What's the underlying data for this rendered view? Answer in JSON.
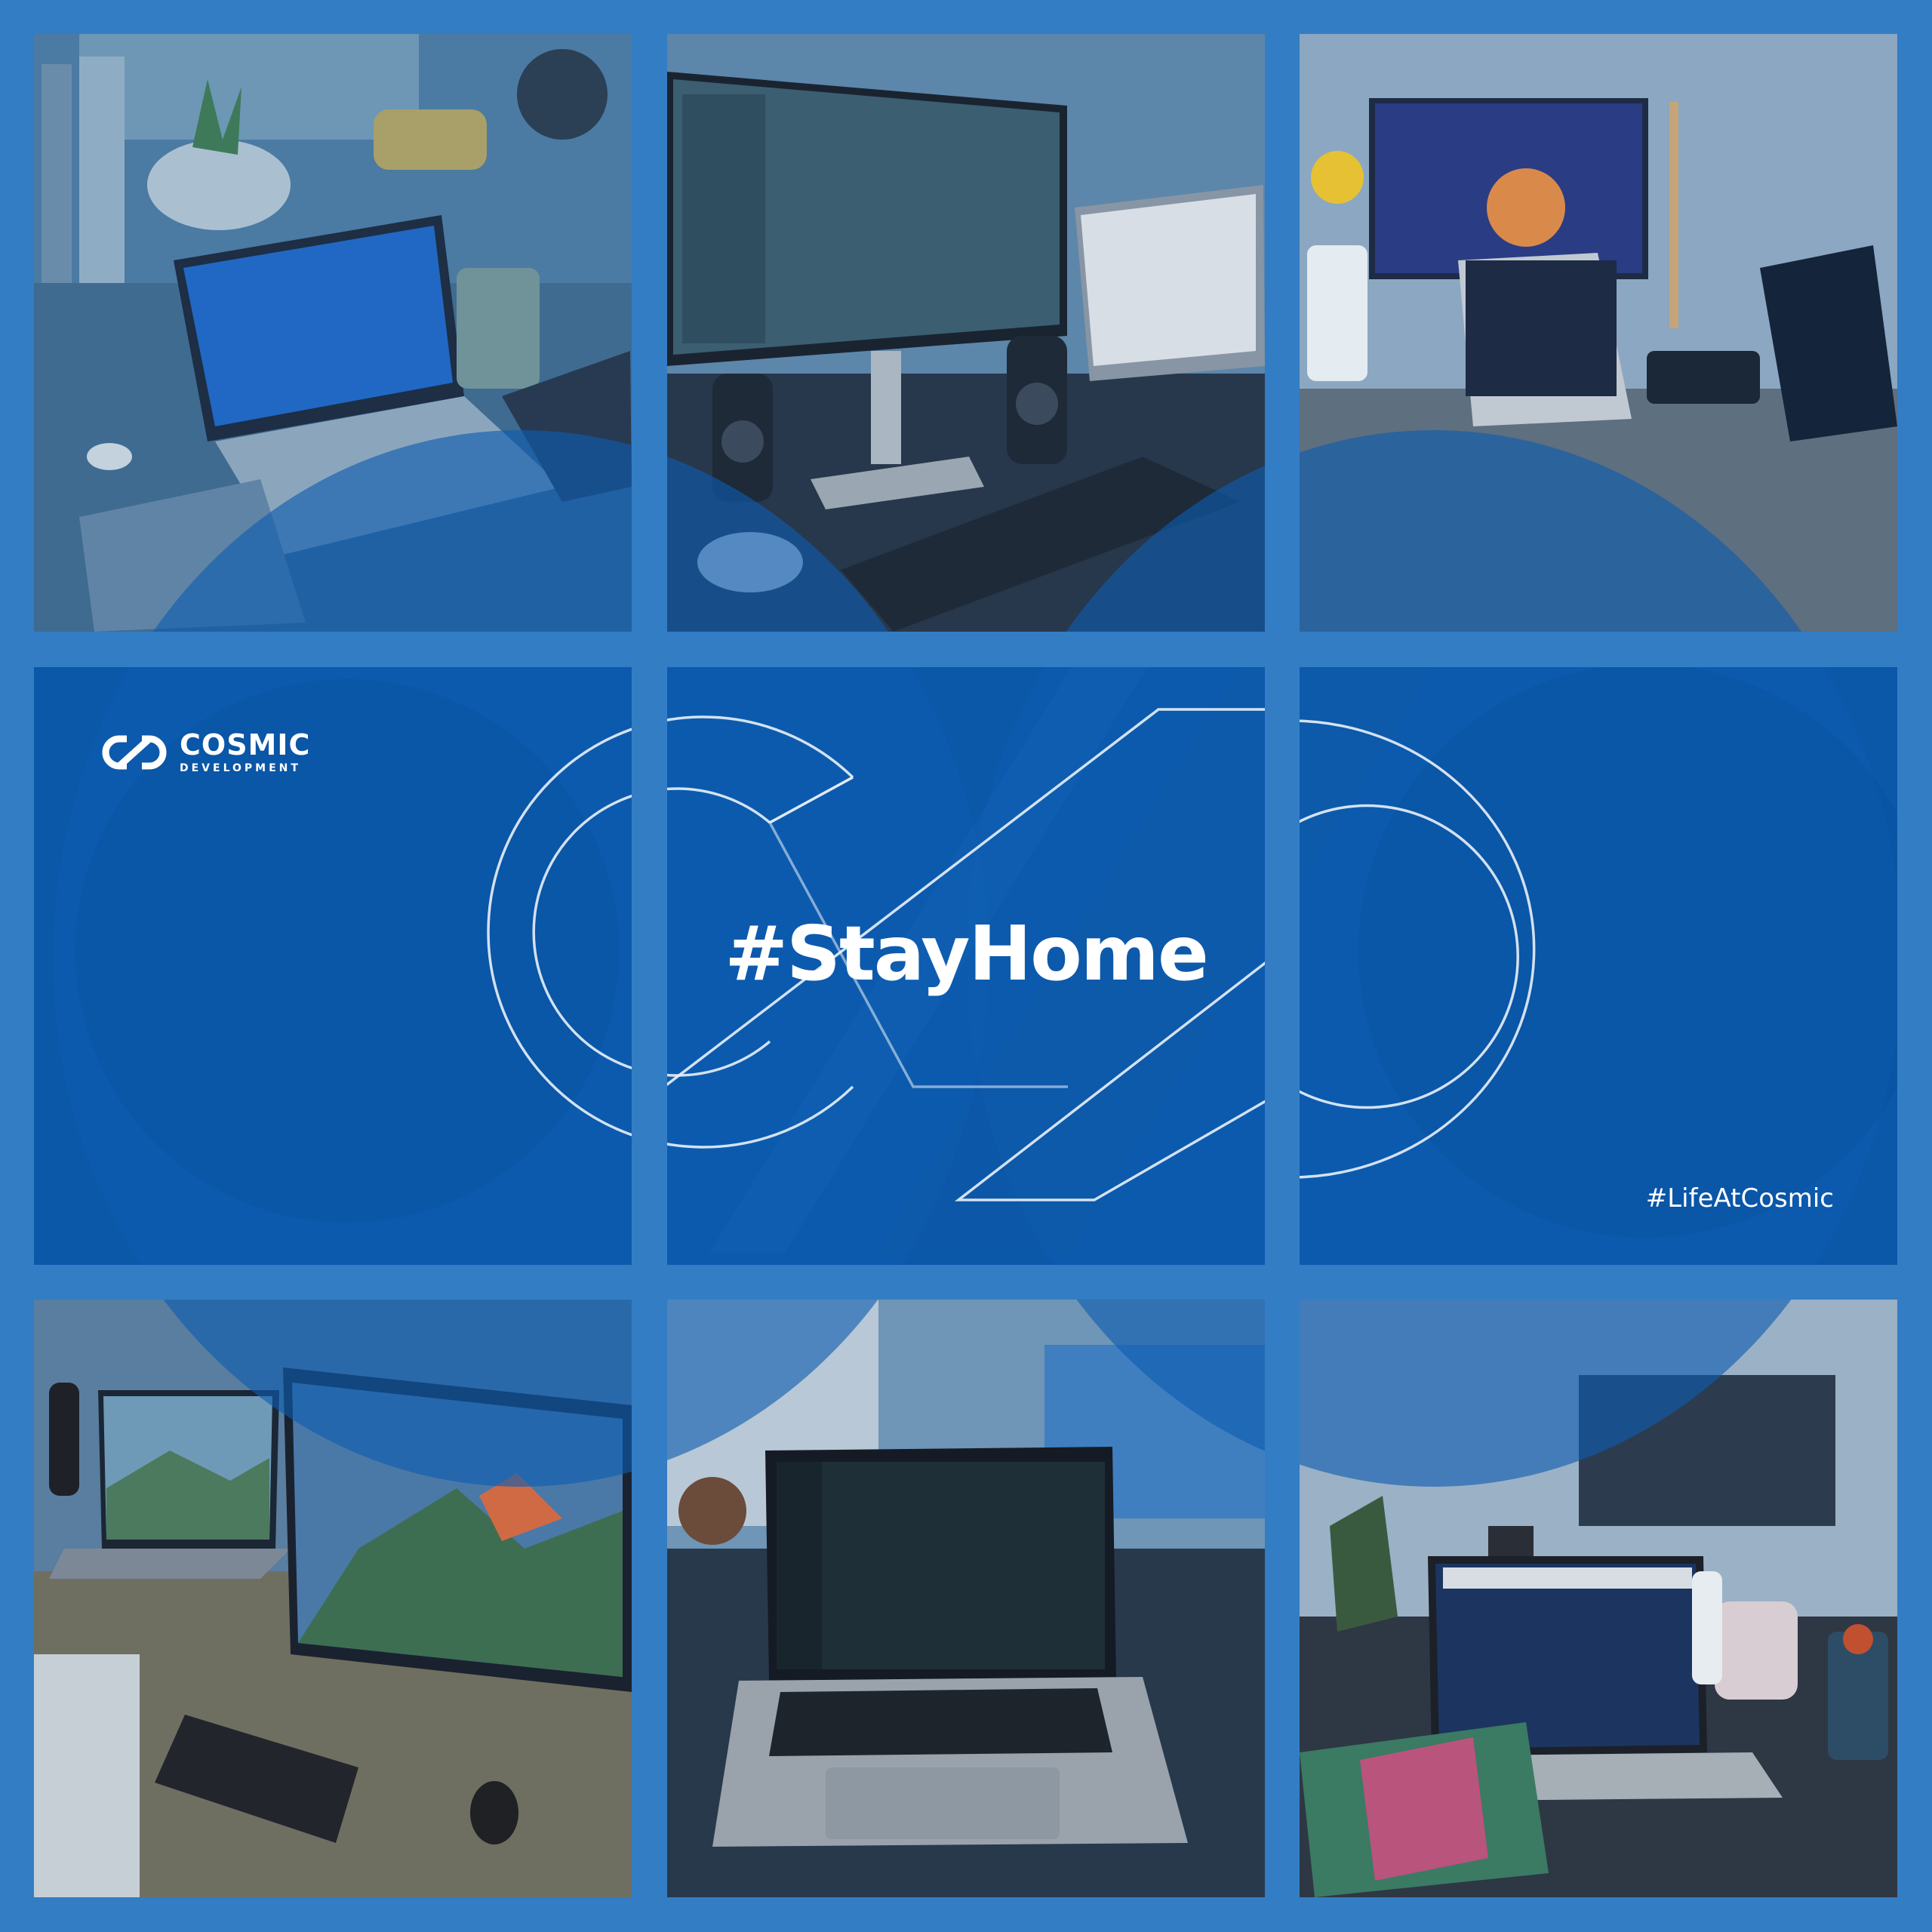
{
  "brand": {
    "name": "COSMIC",
    "subtitle": "DEVELOPMENT",
    "icon": "infinity-link-logo-icon"
  },
  "center": {
    "headline": "#StayHome"
  },
  "hashtag": "#LifeAtCosmic",
  "photo_tiles": [
    {
      "subject": "laptop-on-desk-photo"
    },
    {
      "subject": "dual-monitor-setup-photo"
    },
    {
      "subject": "monitor-with-laptop-photo"
    },
    {
      "subject": "laptop-and-big-monitor-photo"
    },
    {
      "subject": "macbook-code-editor-photo"
    },
    {
      "subject": "laptop-with-mug-photo"
    }
  ],
  "colors": {
    "frame": "#337dc4",
    "tile_blue": "#0b57a8",
    "overlay_blue": "#0d5cb0",
    "text": "#ffffff"
  }
}
